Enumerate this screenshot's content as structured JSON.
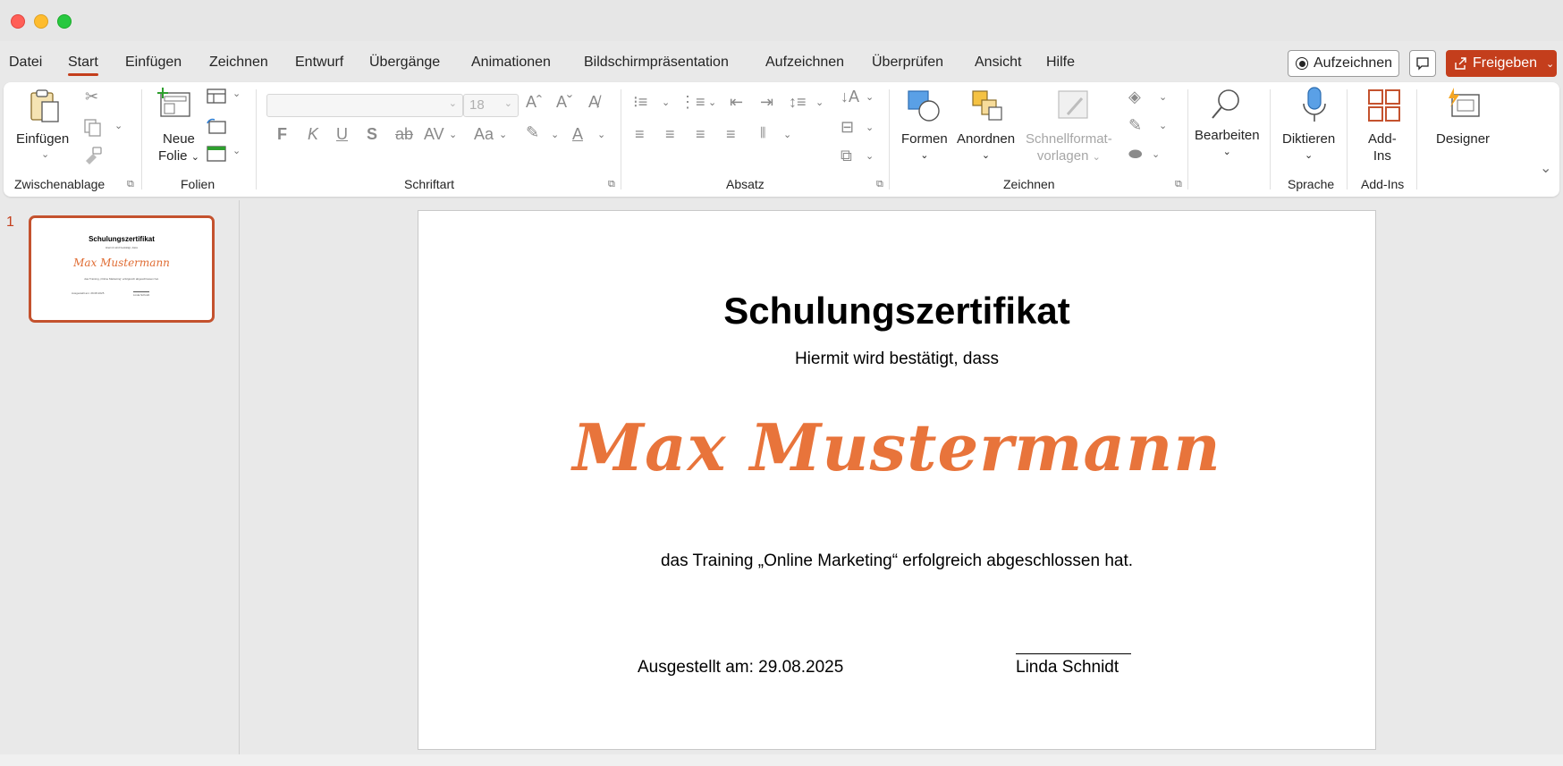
{
  "menu": {
    "tabs": [
      "Datei",
      "Start",
      "Einfügen",
      "Zeichnen",
      "Entwurf",
      "Übergänge",
      "Animationen",
      "Bildschirmpräsentation",
      "Aufzeichnen",
      "Überprüfen",
      "Ansicht",
      "Hilfe"
    ],
    "active_tab": "Start",
    "record_label": "Aufzeichnen",
    "share_label": "Freigeben"
  },
  "ribbon": {
    "clipboard": {
      "paste": "Einfügen",
      "group": "Zwischenablage"
    },
    "slides": {
      "new_slide_1": "Neue",
      "new_slide_2": "Folie",
      "group": "Folien"
    },
    "font": {
      "size_placeholder": "18",
      "group": "Schriftart",
      "bold": "F",
      "italic": "K",
      "underline": "U",
      "shadow": "S",
      "strike": "ab",
      "spacing": "AV",
      "case": "Aa"
    },
    "paragraph": {
      "group": "Absatz"
    },
    "drawing": {
      "shapes": "Formen",
      "arrange": "Anordnen",
      "quickstyles_1": "Schnellformat-",
      "quickstyles_2": "vorlagen",
      "group": "Zeichnen"
    },
    "editing": {
      "label": "Bearbeiten"
    },
    "voice": {
      "dictate": "Diktieren",
      "group": "Sprache"
    },
    "addins": {
      "label_1": "Add-",
      "label_2": "Ins",
      "group": "Add-Ins"
    },
    "designer": {
      "label": "Designer"
    }
  },
  "thumbnails": {
    "slide_number": "1"
  },
  "slide": {
    "title": "Schulungszertifikat",
    "subtitle": "Hiermit wird bestätigt, dass",
    "name": "Max Mustermann",
    "body": "das Training „Online Marketing“ erfolgreich abgeschlossen hat.",
    "date": "Ausgestellt am: 29.08.2025",
    "signatory": "Linda Schnidt"
  },
  "colors": {
    "accent": "#c43e1c",
    "name_color": "#e8743b"
  }
}
